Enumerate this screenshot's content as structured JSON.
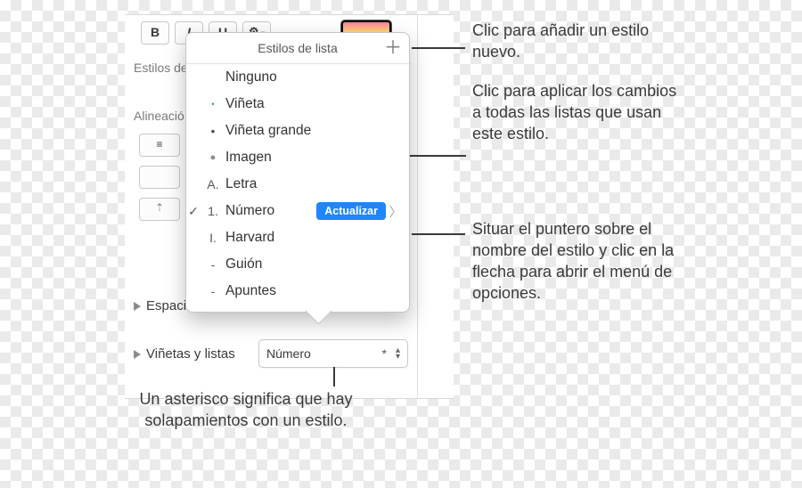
{
  "toolbar": {
    "bold": "B",
    "italic": "I",
    "underline": "U",
    "gear": "✻▾"
  },
  "sidebar": {
    "styles_label": "Estilos de",
    "align_label": "Alineació",
    "spacing_label": "Espaci",
    "bullets_label": "Viñetas y listas"
  },
  "dropdown": {
    "value": "Número",
    "asterisk": "*"
  },
  "popover": {
    "title": "Estilos de lista",
    "add": "＋",
    "update_label": "Actualizar",
    "items": [
      {
        "prefix": "",
        "label": "Ninguno"
      },
      {
        "prefix": "•",
        "label": "Viñeta",
        "prefix_color": "#2fa35a",
        "prefix_size": "9px"
      },
      {
        "prefix": "•",
        "label": "Viñeta grande"
      },
      {
        "prefix": "●",
        "label": "Imagen",
        "prefix_color": "#8b8b8b",
        "prefix_size": "11px"
      },
      {
        "prefix": "A.",
        "label": "Letra"
      },
      {
        "prefix": "1.",
        "label": "Número",
        "checked": true,
        "update": true,
        "arrow": true
      },
      {
        "prefix": "I.",
        "label": "Harvard"
      },
      {
        "prefix": "-",
        "label": "Guión"
      },
      {
        "prefix": "-",
        "label": "Apuntes"
      }
    ]
  },
  "callouts": {
    "add": "Clic para añadir un estilo nuevo.",
    "update": "Clic para aplicar los cambios a todas las listas que usan este estilo.",
    "arrow": "Situar el puntero sobre el nombre del estilo y clic en la flecha para abrir el menú de opciones.",
    "asterisk": "Un asterisco significa que hay solapamientos con un estilo."
  }
}
